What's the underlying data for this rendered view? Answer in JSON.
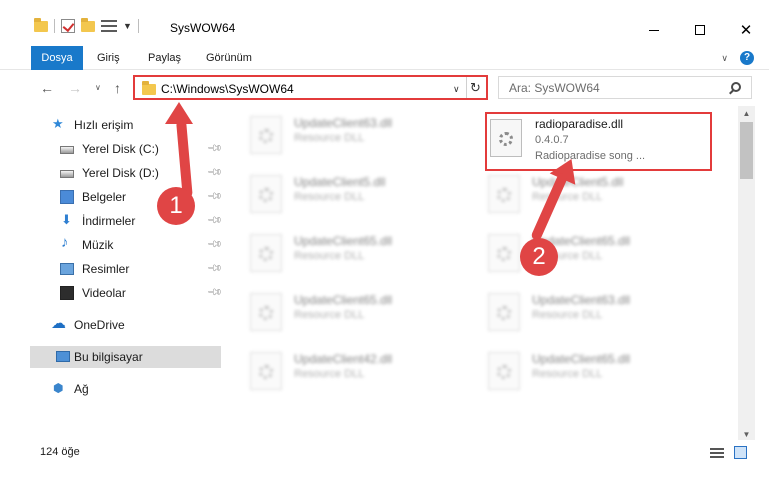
{
  "window": {
    "title": "SysWOW64"
  },
  "ribbon": {
    "file_tab": "Dosya",
    "tabs": [
      "Giriş",
      "Paylaş",
      "Görünüm"
    ],
    "help": "?"
  },
  "nav": {
    "address": "C:\\Windows\\SysWOW64",
    "search_placeholder": "Ara: SysWOW64"
  },
  "sidebar": {
    "quick_access": "Hızlı erişim",
    "items": [
      "Yerel Disk (C:)",
      "Yerel Disk (D:)",
      "Belgeler",
      "İndirmeler",
      "Müzik",
      "Resimler",
      "Videolar"
    ],
    "onedrive": "OneDrive",
    "this_pc": "Bu bilgisayar",
    "network": "Ağ"
  },
  "files": {
    "left": [
      {
        "name": "UpdateClient63.dll",
        "desc": "Resource DLL"
      },
      {
        "name": "UpdateClient5.dll",
        "desc": "Resource DLL"
      },
      {
        "name": "UpdateClient65.dll",
        "desc": "Resource DLL"
      },
      {
        "name": "UpdateClient65.dll",
        "desc": "Resource DLL"
      },
      {
        "name": "UpdateClient42.dll",
        "desc": "Resource DLL"
      }
    ],
    "right": [
      {
        "name": "UpdateClient5.dll",
        "desc": "Resource DLL"
      },
      {
        "name": "UpdateClient65.dll",
        "desc": "Resource DLL"
      },
      {
        "name": "UpdateClient63.dll",
        "desc": "Resource DLL"
      },
      {
        "name": "UpdateClient65.dll",
        "desc": "Resource DLL"
      }
    ],
    "highlighted": {
      "name": "radioparadise.dll",
      "version": "0.4.0.7",
      "desc": "Radioparadise song ..."
    }
  },
  "status": {
    "count": "124 öğe"
  },
  "annotations": {
    "step1": "1",
    "step2": "2",
    "color": "#e04545"
  },
  "colors": {
    "accent": "#1979ca",
    "highlight_border": "#e33b3b"
  }
}
